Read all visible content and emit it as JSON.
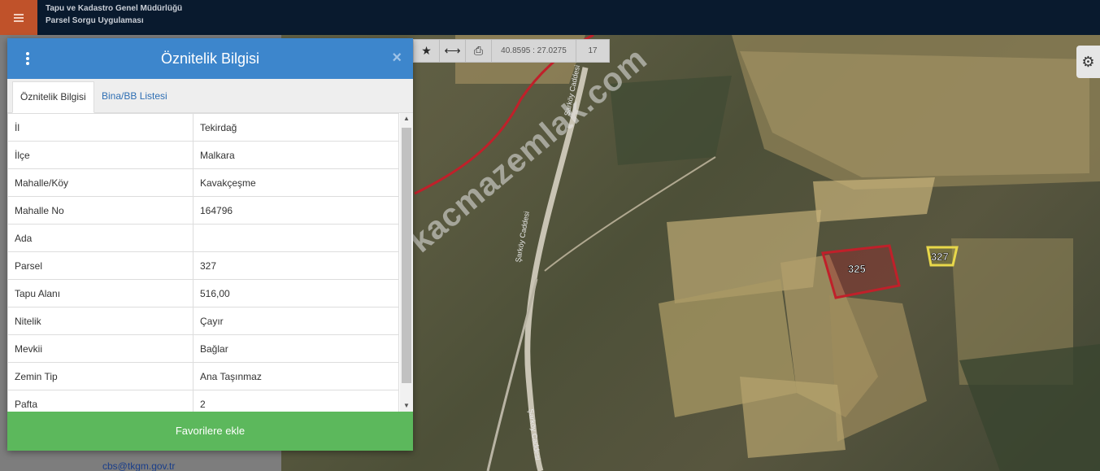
{
  "app": {
    "title_line1": "Tapu ve Kadastro Genel Müdürlüğü",
    "title_line2": "Parsel Sorgu Uygulaması"
  },
  "map": {
    "coordinates": "40.8595 : 27.0275",
    "zoom": "17",
    "watermark": "kacmazemlak.com",
    "parcel_labels": [
      "325",
      "327"
    ],
    "road_labels": [
      "Şarköy Caddesi",
      "Şarköy Caddesi",
      "Şarköy Caddesi"
    ],
    "highlight_color": "#c0202a",
    "neighbor_color": "#e8d84a"
  },
  "modal": {
    "title": "Öznitelik Bilgisi",
    "tabs": [
      {
        "label": "Öznitelik Bilgisi",
        "active": true
      },
      {
        "label": "Bina/BB Listesi",
        "active": false
      }
    ],
    "rows": [
      {
        "key": "İl",
        "value": "Tekirdağ"
      },
      {
        "key": "İlçe",
        "value": "Malkara"
      },
      {
        "key": "Mahalle/Köy",
        "value": "Kavakçeşme"
      },
      {
        "key": "Mahalle No",
        "value": "164796"
      },
      {
        "key": "Ada",
        "value": ""
      },
      {
        "key": "Parsel",
        "value": "327"
      },
      {
        "key": "Tapu Alanı",
        "value": "516,00"
      },
      {
        "key": "Nitelik",
        "value": "Çayır"
      },
      {
        "key": "Mevkii",
        "value": "Bağlar"
      },
      {
        "key": "Zemin Tip",
        "value": "Ana Taşınmaz"
      },
      {
        "key": "Pafta",
        "value": "2"
      }
    ],
    "favorite_button": "Favorilere ekle"
  },
  "footer": {
    "contact_email": "cbs@tkgm.gov.tr"
  },
  "colors": {
    "topbar": "#091a2e",
    "menu": "#c0522a",
    "header": "#3d86cc",
    "favorite": "#5cb85c"
  }
}
